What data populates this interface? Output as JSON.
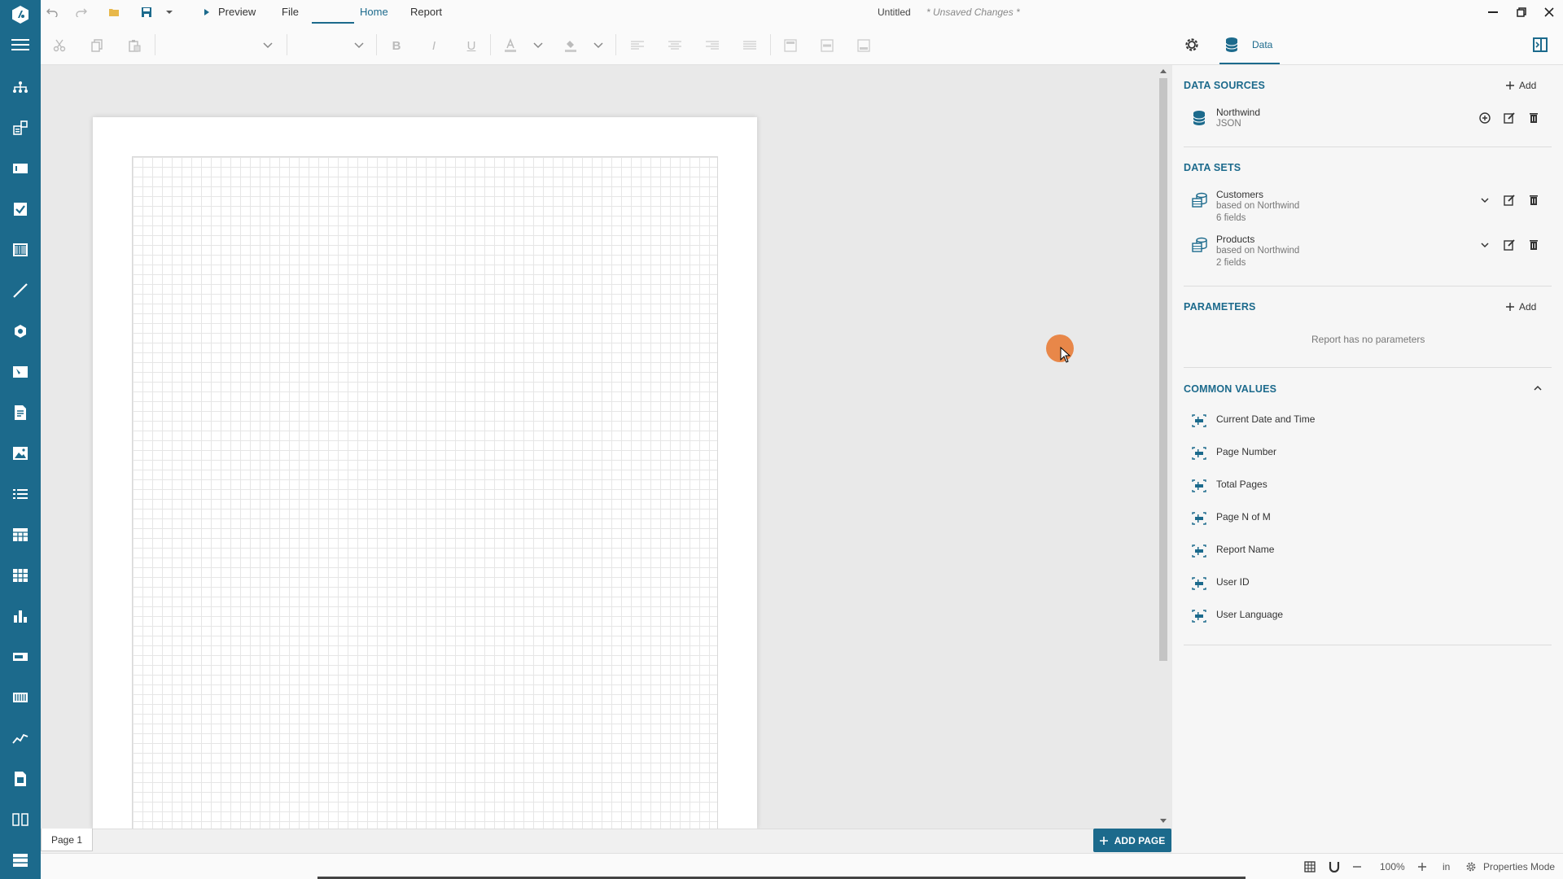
{
  "titlebar": {
    "preview_label": "Preview",
    "menus": [
      "File",
      "Home",
      "Report"
    ],
    "doc_title": "Untitled",
    "doc_status": "* Unsaved Changes *"
  },
  "panel_head": {
    "data_tab_label": "Data"
  },
  "data_sources": {
    "title": "DATA SOURCES",
    "add_label": "Add",
    "items": [
      {
        "name": "Northwind",
        "type": "JSON"
      }
    ]
  },
  "data_sets": {
    "title": "DATA SETS",
    "items": [
      {
        "name": "Customers",
        "based_on": "based on Northwind",
        "fields": "6 fields"
      },
      {
        "name": "Products",
        "based_on": "based on Northwind",
        "fields": "2 fields"
      }
    ]
  },
  "parameters": {
    "title": "PARAMETERS",
    "add_label": "Add",
    "empty_text": "Report has no parameters"
  },
  "common_values": {
    "title": "COMMON VALUES",
    "items": [
      "Current Date and Time",
      "Page Number",
      "Total Pages",
      "Page N of M",
      "Report Name",
      "User ID",
      "User Language"
    ]
  },
  "pages": {
    "tab_label": "Page 1",
    "add_page_label": "ADD PAGE"
  },
  "statusbar": {
    "zoom": "100%",
    "unit": "in",
    "mode_label": "Properties Mode"
  },
  "colors": {
    "accent": "#1c6a8c",
    "cursor_highlight": "#e8762d"
  }
}
